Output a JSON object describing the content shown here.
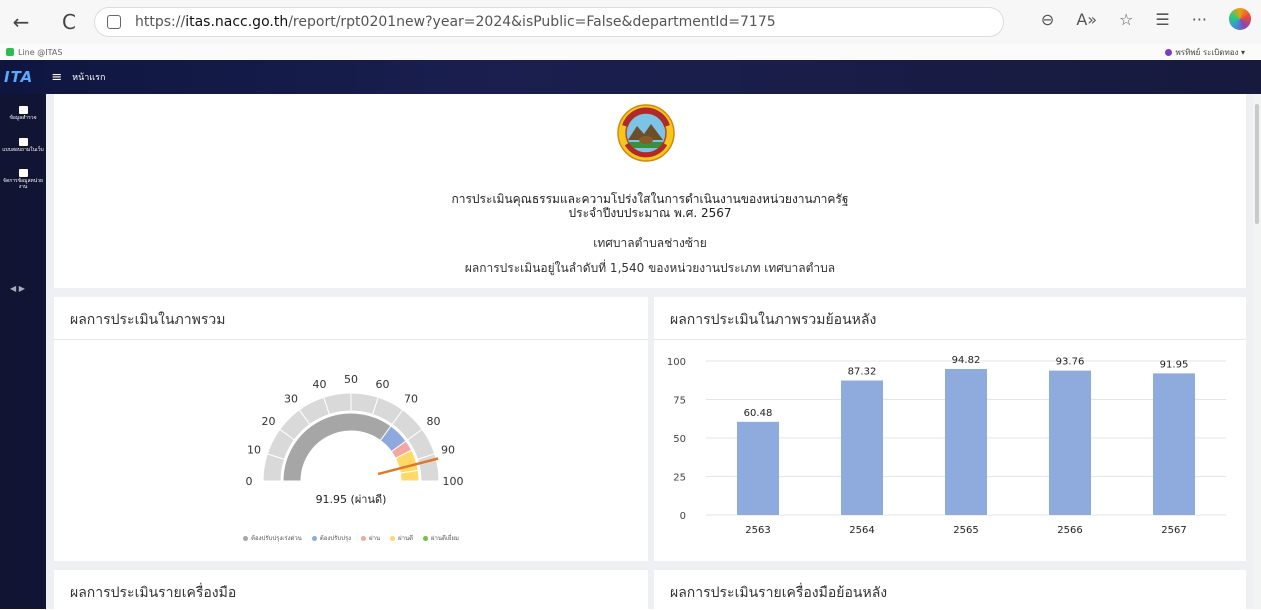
{
  "browser": {
    "url_prefix": "https://",
    "url_host": "itas.nacc.go.th",
    "url_path": "/report/rpt0201new?year=2024&isPublic=False&departmentId=7175",
    "back": "←",
    "refresh": "C"
  },
  "favorites": {
    "item": "Line @ITAS"
  },
  "user": {
    "name": "พรทิพย์ ระเบิดทอง ▾"
  },
  "header": {
    "logo": "ITA",
    "home": "หน้าแรก"
  },
  "sidebar": {
    "items": [
      {
        "label": "ข้อมูลสำรวจ"
      },
      {
        "label": "แบบสอบถามในเว็บ"
      },
      {
        "label": "จัดการข้อมูลหน่วยงาน"
      }
    ],
    "toggle": "◀ ▶"
  },
  "report": {
    "title_line1": "การประเมินคุณธรรมและความโปร่งใสในการดำเนินงานของหน่วยงานภาครัฐ",
    "title_line2": "ประจำปีงบประมาณ พ.ศ. 2567",
    "org": "เทศบาลตำบลช่างซ้าย",
    "rank_text": "ผลการประเมินอยู่ในลำดับที่ 1,540 ของหน่วยงานประเภท เทศบาลตำบล"
  },
  "panels": {
    "overall_title": "ผลการประเมินในภาพรวม",
    "history_title": "ผลการประเมินในภาพรวมย้อนหลัง",
    "tools_title": "ผลการประเมินรายเครื่องมือ",
    "tools_history_title": "ผลการประเมินรายเครื่องมือย้อนหลัง"
  },
  "gauge": {
    "value": 91.95,
    "value_label": "91.95 (ผ่านดี)",
    "ticks": [
      "0",
      "10",
      "20",
      "30",
      "40",
      "50",
      "60",
      "70",
      "80",
      "90",
      "100"
    ],
    "legend": [
      {
        "label": "ต้องปรับปรุงเร่งด่วน",
        "color": "#a6a6a6"
      },
      {
        "label": "ต้องปรับปรุง",
        "color": "#8ea9db"
      },
      {
        "label": "ผ่าน",
        "color": "#f4a6a0"
      },
      {
        "label": "ผ่านดี",
        "color": "#ffd966"
      },
      {
        "label": "ผ่านดีเยี่ยม",
        "color": "#70c04a"
      }
    ]
  },
  "chart_data": {
    "type": "bar",
    "categories": [
      "2563",
      "2564",
      "2565",
      "2566",
      "2567"
    ],
    "values": [
      60.48,
      87.32,
      94.82,
      93.76,
      91.95
    ],
    "value_labels": [
      "60.48",
      "87.32",
      "94.82",
      "93.76",
      "91.95"
    ],
    "y_ticks": [
      "0",
      "25",
      "50",
      "75",
      "100"
    ],
    "ylim": [
      0,
      100
    ],
    "bar_color": "#8faadc",
    "grid": true,
    "title": "",
    "xlabel": "",
    "ylabel": ""
  }
}
